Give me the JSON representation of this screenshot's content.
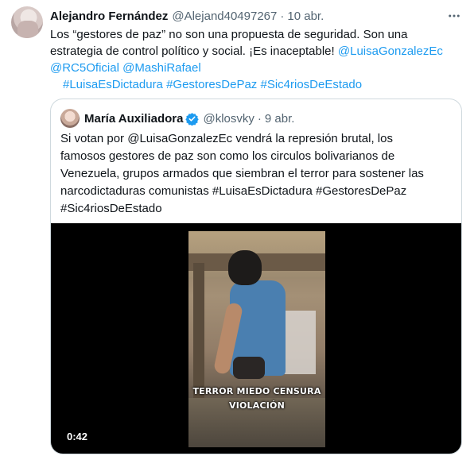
{
  "tweet": {
    "author_name": "Alejandro Fernández",
    "handle": "@Alejand40497267",
    "separator": "·",
    "date": "10 abr.",
    "more_icon": "more-horizontal-icon",
    "text_lines": [
      {
        "plain": "Los “gestores de paz” no son una propuesta de seguridad. Son una"
      },
      {
        "plain": "estrategia de control político y social. ¡Es inaceptable! ",
        "link": "@LuisaGonzalezEc"
      },
      {
        "links": [
          "@RC5Oficial",
          "@MashiRafael"
        ]
      },
      {
        "links": [
          "#LuisaEsDictadura",
          "#GestoresDePaz",
          "#Sic4riosDeEstado"
        ]
      }
    ]
  },
  "quote": {
    "author_name": "María Auxiliadora",
    "verified_icon": "verified-badge-icon",
    "handle": "@klosvky",
    "separator": "·",
    "date": "9 abr.",
    "text_lines": [
      "Si votan por @LuisaGonzalezEc vendrá la represión brutal, los",
      "famosos gestores de paz son como los circulos bolivarianos de",
      "Venezuela, grupos armados que siembran el terror para sostener las",
      "narcodictaduras comunistas #LuisaEsDictadura #GestoresDePaz",
      "#Sic4riosDeEstado"
    ],
    "media": {
      "caption_line1": "TERROR MIEDO CENSURA",
      "caption_line2": "VIOLACIÓN",
      "duration": "0:42"
    }
  },
  "colors": {
    "text": "#0f1419",
    "muted": "#536471",
    "link": "#1d9bf0",
    "border": "#cfd9de"
  }
}
